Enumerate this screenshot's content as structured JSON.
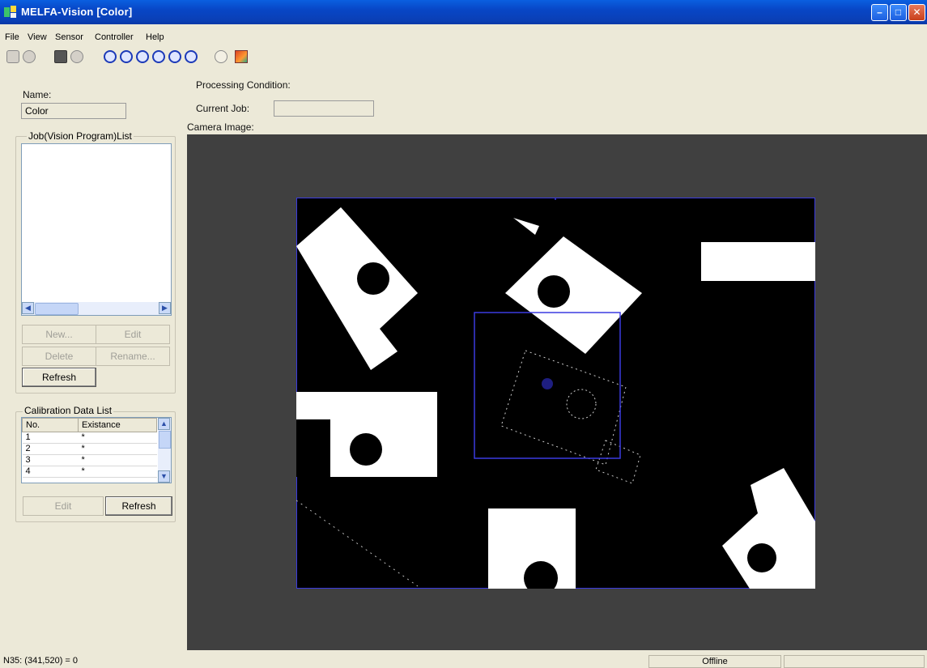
{
  "window": {
    "title": "MELFA-Vision [Color]"
  },
  "menu": [
    "File",
    "View",
    "Sensor",
    "Controller",
    "Help"
  ],
  "toolbar": {
    "icons": [
      "select-icon",
      "stop-icon",
      "camera-icon",
      "refresh-icon",
      "zoom-in-icon",
      "zoom-out-icon",
      "zoom-fit-icon",
      "zoom-actual-icon",
      "zoom-window-icon",
      "zoom-reset-icon",
      "find-icon",
      "image-icon"
    ]
  },
  "left_panel": {
    "name_label": "Name:",
    "name_value": "Color",
    "job_list_title": "Job(Vision Program)List",
    "job_buttons": {
      "new": "New...",
      "edit": "Edit",
      "delete": "Delete",
      "rename": "Rename...",
      "refresh": "Refresh"
    },
    "calibration": {
      "title": "Calibration Data List",
      "columns": [
        "No.",
        "Existance"
      ],
      "rows": [
        {
          "no": "1",
          "exists": "*"
        },
        {
          "no": "2",
          "exists": "*"
        },
        {
          "no": "3",
          "exists": "*"
        },
        {
          "no": "4",
          "exists": "*"
        }
      ],
      "edit": "Edit",
      "refresh": "Refresh"
    }
  },
  "main": {
    "processing_condition_label": "Processing Condition:",
    "current_job_label": "Current Job:",
    "current_job_value": "",
    "camera_image_label": "Camera Image:"
  },
  "status": {
    "coordinates": "N35: (341,520) = 0",
    "connection": "Offline"
  },
  "colors": {
    "titlebar": "#0a46c6",
    "window_bg": "#ece9d8",
    "camera_bg": "#404040",
    "overlay": "#3a3ae0"
  }
}
